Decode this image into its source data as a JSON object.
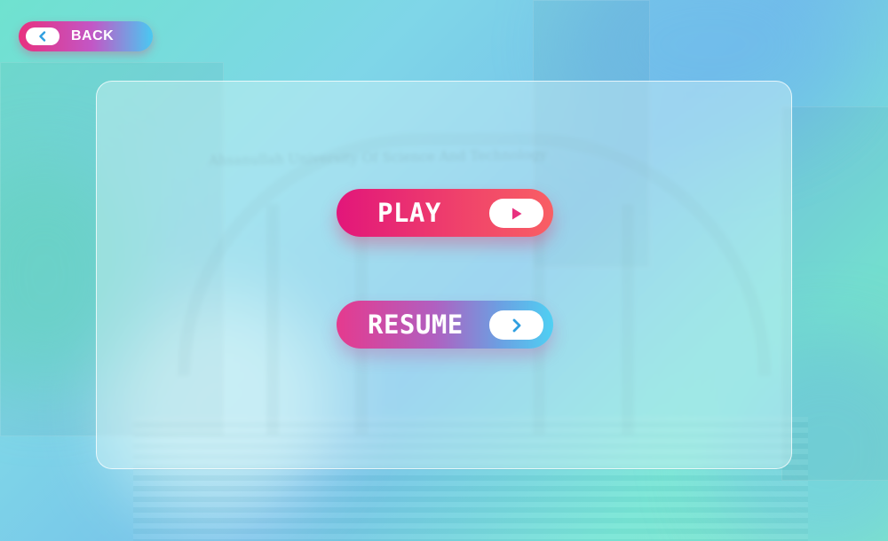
{
  "background": {
    "banner_text": "Ahsanullah University Of Science And Technology"
  },
  "header": {
    "back_label": "BACK",
    "back_icon": "chevron-left-icon"
  },
  "menu": {
    "play_label": "PLAY",
    "play_icon": "play-icon",
    "resume_label": "RESUME",
    "resume_icon": "chevron-right-icon"
  },
  "colors": {
    "play_start": "#e2167a",
    "play_end": "#f95f64",
    "resume_start": "#e53a8e",
    "resume_end": "#4fd0f3",
    "icon_accent": "#e8307f",
    "icon_blue": "#2f9fe0"
  }
}
